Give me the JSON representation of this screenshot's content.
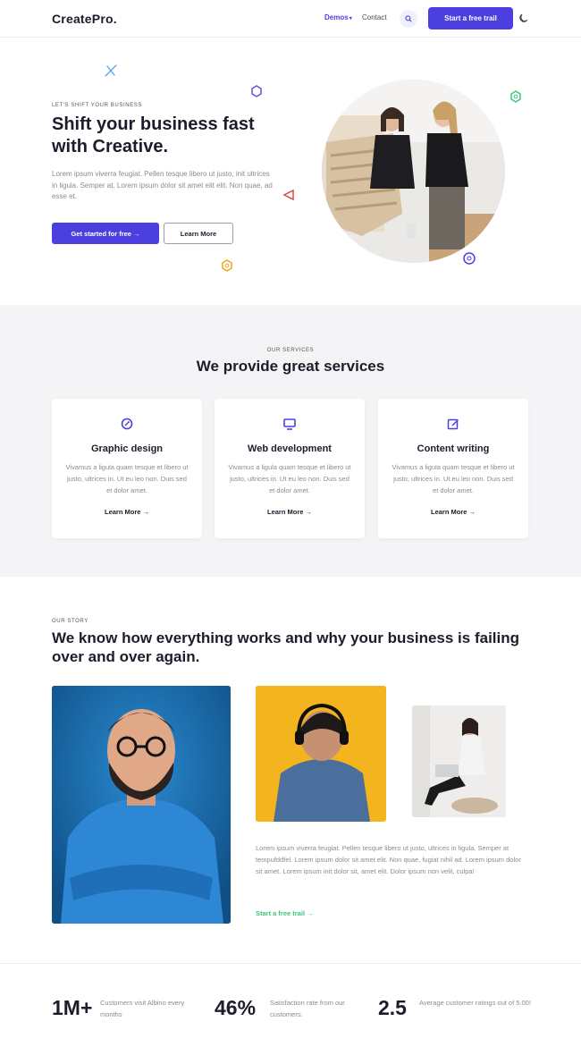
{
  "header": {
    "brand": "CreatePro.",
    "nav": {
      "demos": "Demos",
      "contact": "Contact"
    },
    "cta": "Start a free trail"
  },
  "hero": {
    "kicker": "LET'S SHIFT YOUR BUSINESS",
    "title": "Shift your business fast with Creative.",
    "text": "Lorem ipsum viverra feugiat. Pellen tesque libero ut justo, init ultrices in ligula. Semper at. Lorem ipsum dolor sit amet elit elit. Non quae, ad esse et.",
    "primary_button": "Get started for free →",
    "secondary_button": "Learn More"
  },
  "services": {
    "kicker": "OUR SERVICES",
    "title": "We provide great services",
    "cards": [
      {
        "title": "Graphic design",
        "text": "Vivamus a ligula quam tesque et libero ut justo, ultrices in. Ut eu leo non. Duis sed et dolor amet.",
        "link": "Learn More →",
        "icon": "rocket-icon"
      },
      {
        "title": "Web development",
        "text": "Vivamus a ligula quam tesque et libero ut justo, ultrices in. Ut eu leo non. Duis sed et dolor amet.",
        "link": "Learn More →",
        "icon": "monitor-icon"
      },
      {
        "title": "Content writing",
        "text": "Vivamus a ligula quam tesque et libero ut justo, ultrices in. Ut eu leo non. Duis sed et dolor amet.",
        "link": "Learn More →",
        "icon": "edit-icon"
      }
    ]
  },
  "story": {
    "kicker": "OUR STORY",
    "title": "We know how everything works and why your business is failing over and over again.",
    "text": "Lorem ipsum viverra feugiat. Pellen tesque libero ut justo, ultrices in ligula. Semper at tempufddfel. Lorem ipsum dolor sit amet elit. Non quae, fugiat nihil ad. Lorem ipsum dolor sit amet. Lorem ipsum init dolor sit, amet elit. Dolor ipsum non velit, culpa!",
    "link": "Start a free trail →"
  },
  "stats": [
    {
      "value": "1M+",
      "label": "Customers visit Albino every months"
    },
    {
      "value": "46%",
      "label": "Satisfaction rate from our customers."
    },
    {
      "value": "2.5",
      "label": "Average customer ratings out of 5.00!"
    }
  ],
  "colors": {
    "accent": "#4b3fe0",
    "green": "#3ec57a",
    "section_bg": "#f4f4f6"
  }
}
